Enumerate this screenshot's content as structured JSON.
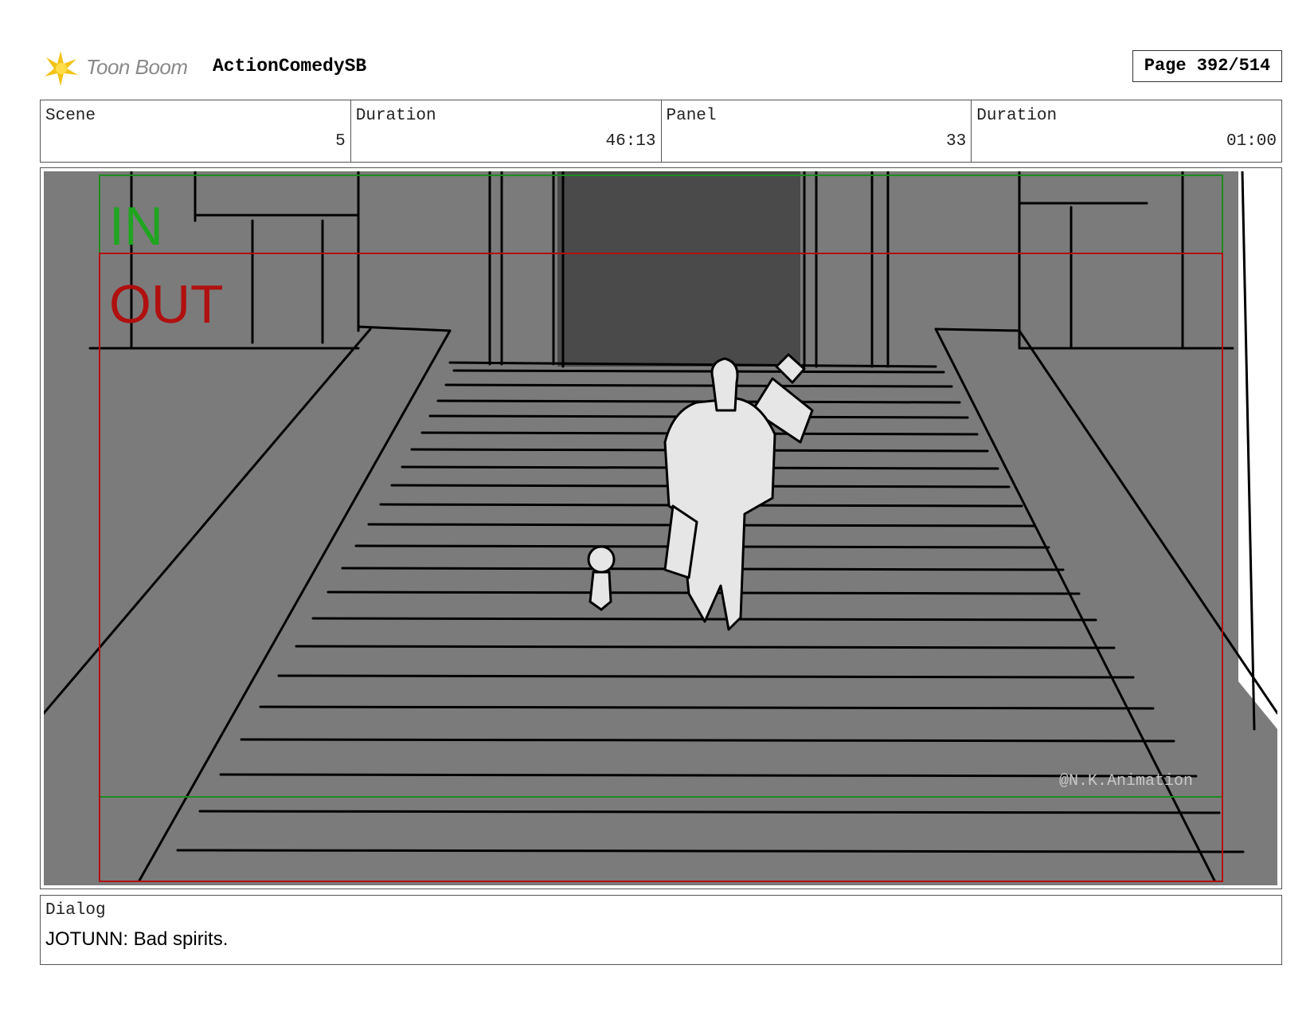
{
  "header": {
    "brand": "Toon Boom",
    "project": "ActionComedySB",
    "page": "Page 392/514"
  },
  "info": {
    "scene_label": "Scene",
    "scene_value": "5",
    "scene_duration_label": "Duration",
    "scene_duration_value": "46:13",
    "panel_label": "Panel",
    "panel_value": "33",
    "panel_duration_label": "Duration",
    "panel_duration_value": "01:00"
  },
  "panel": {
    "in_label": "IN",
    "out_label": "OUT",
    "watermark": "@N.K.Animation",
    "colors": {
      "background": "#7b7b7b",
      "doorway": "#4a4a4a",
      "in_frame": "#1f8a1f",
      "out_frame": "#b01010",
      "line": "#000000",
      "figure": "#e6e6e6"
    }
  },
  "dialog": {
    "label": "Dialog",
    "text": "JOTUNN: Bad spirits."
  }
}
